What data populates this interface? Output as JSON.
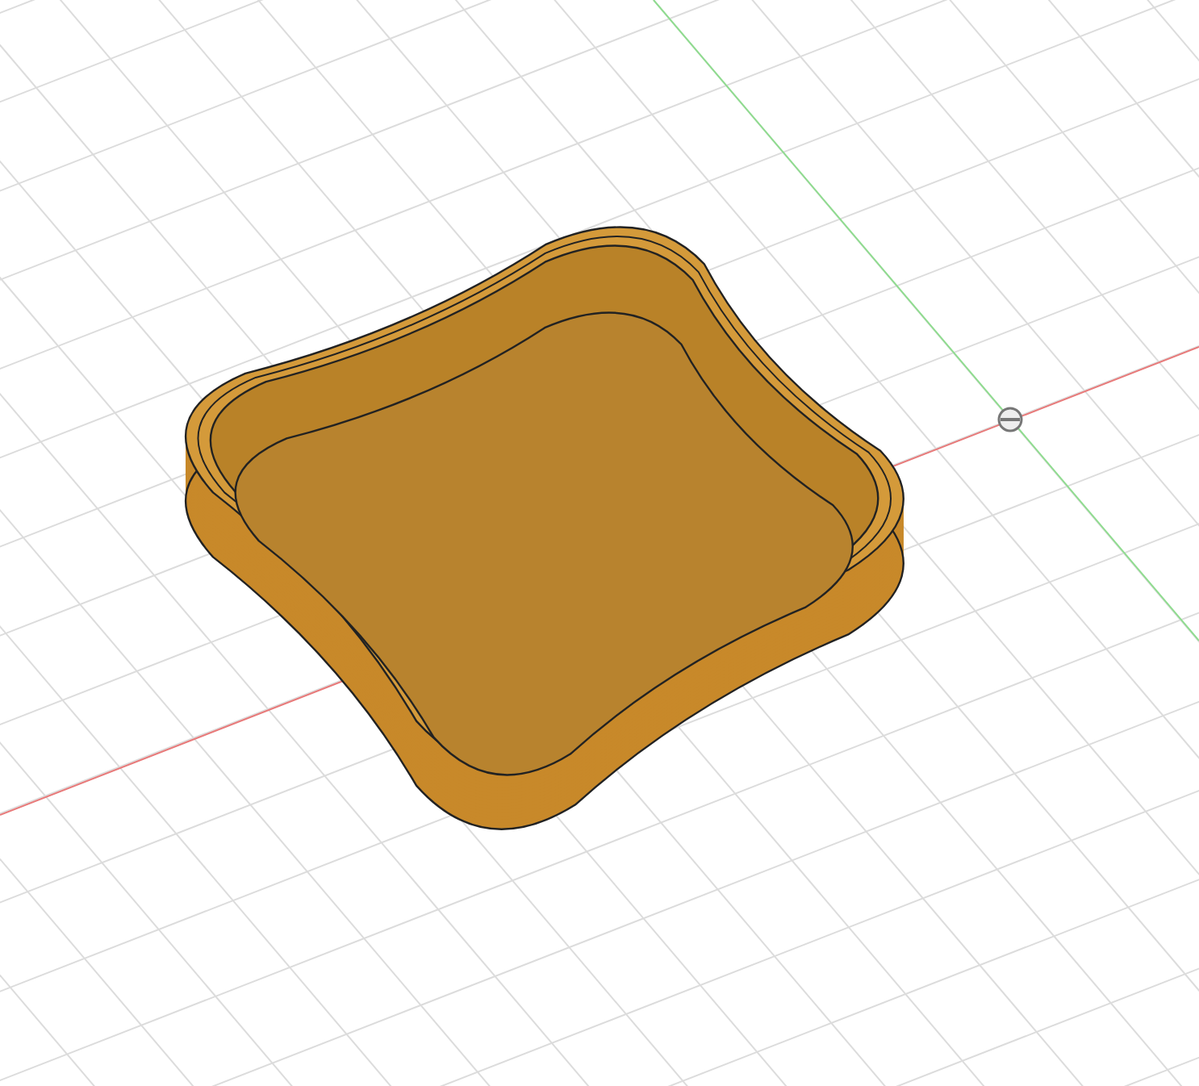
{
  "viewport": {
    "show_grid": true,
    "show_axes": true,
    "show_origin": true,
    "model": {
      "kind": "tray"
    }
  }
}
